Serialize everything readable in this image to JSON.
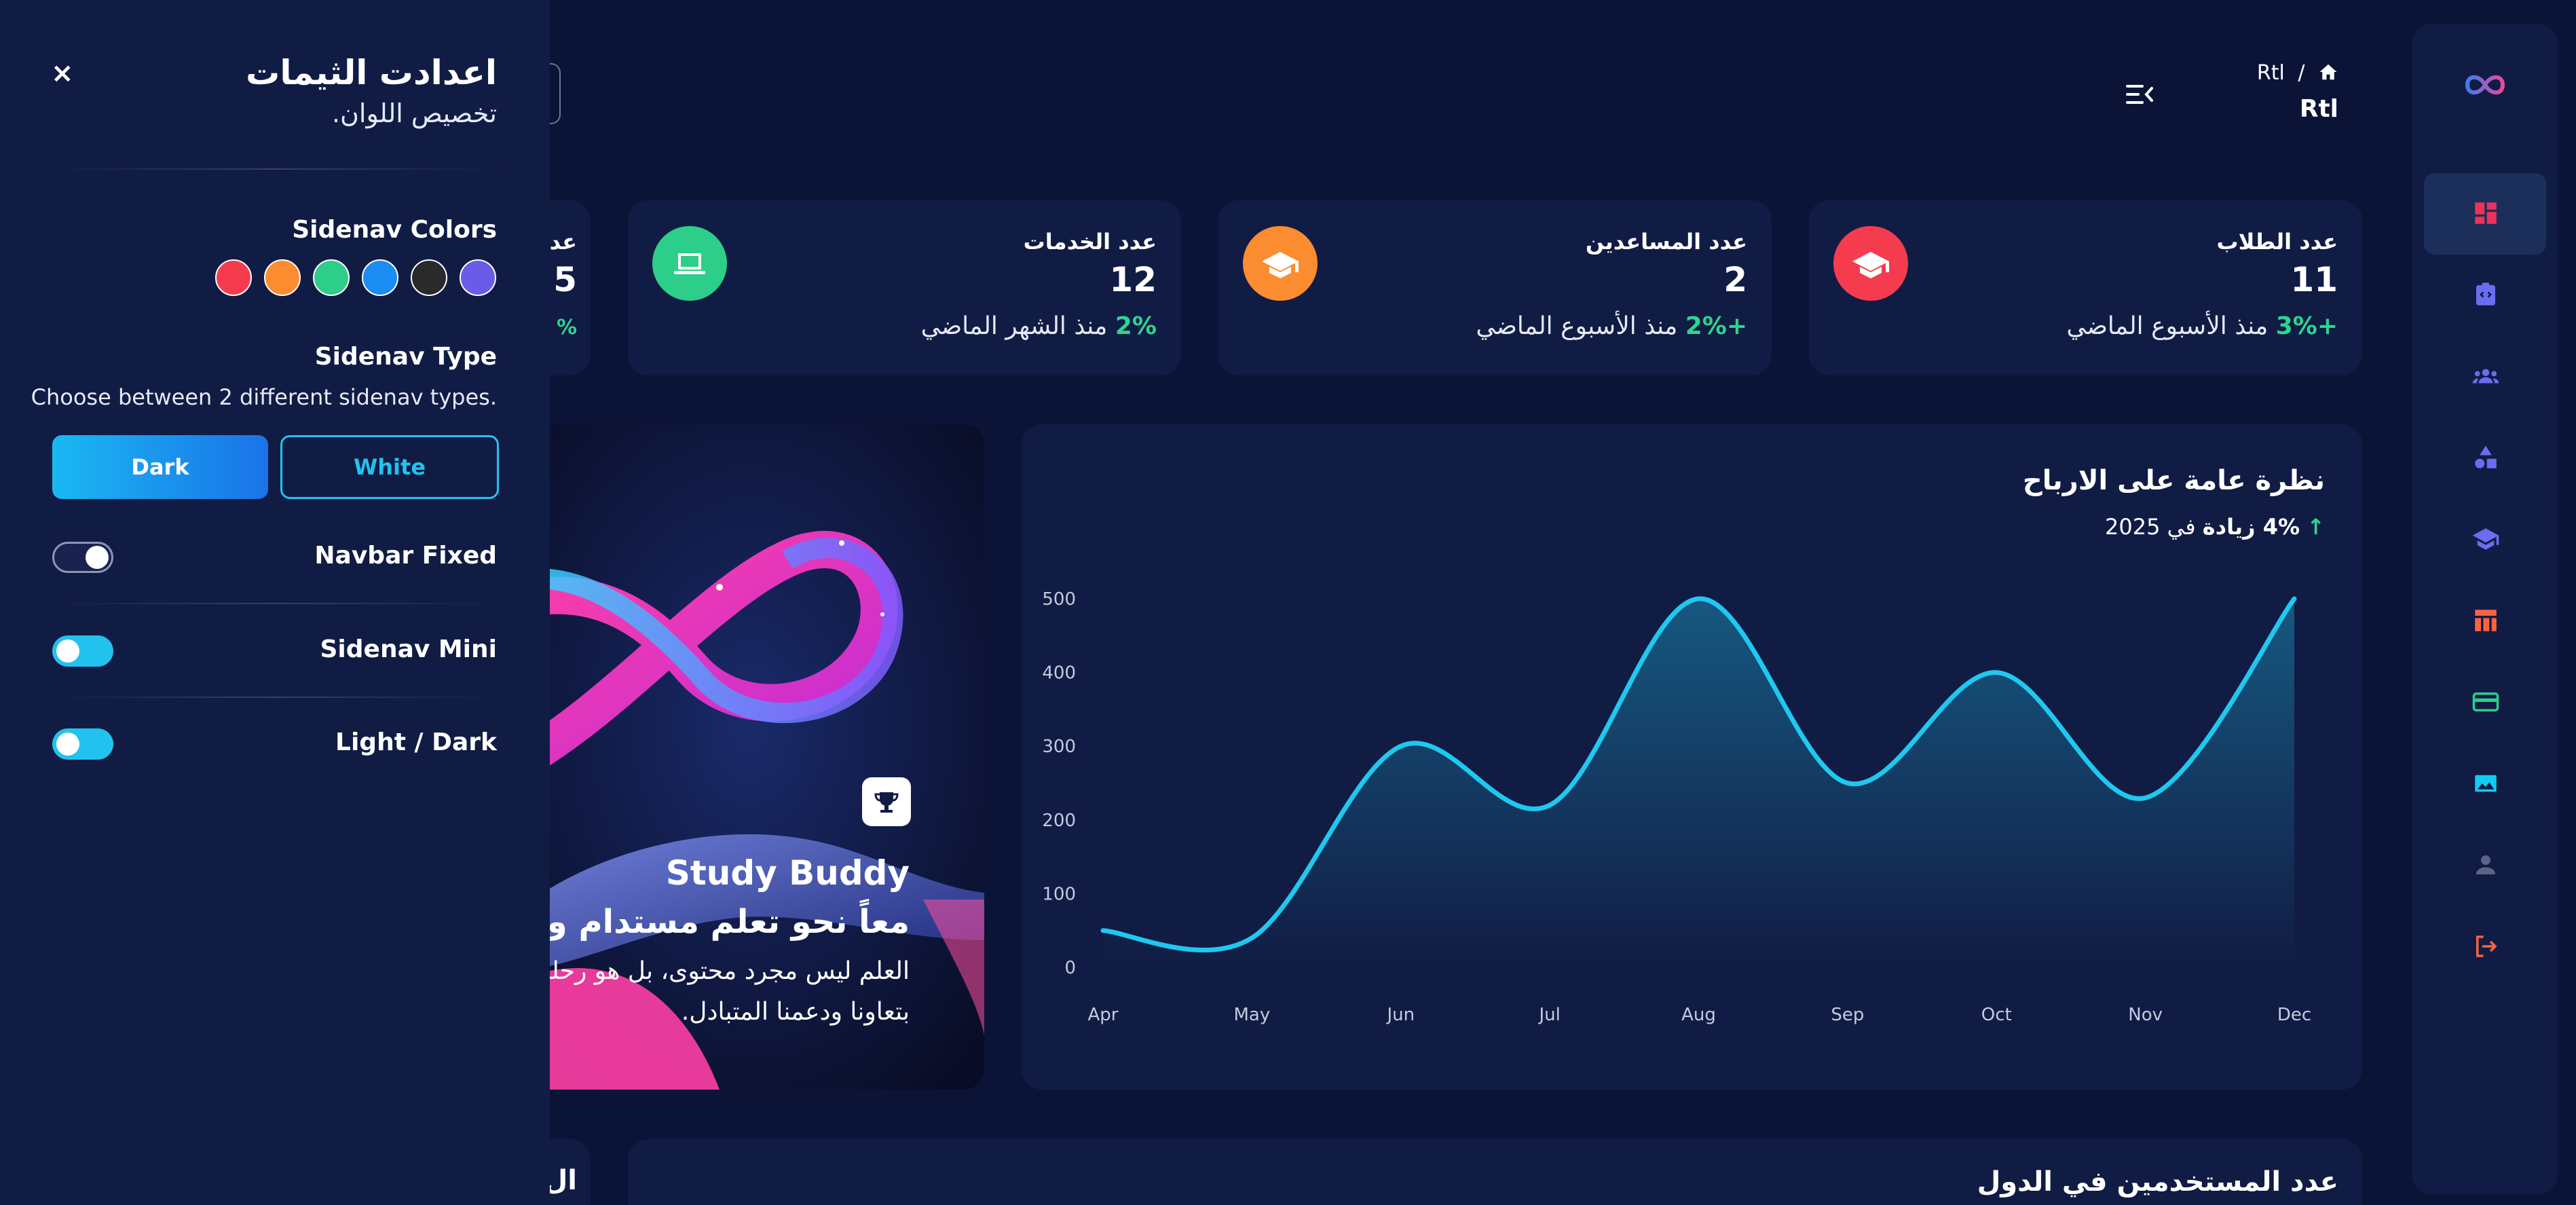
{
  "breadcrumb": {
    "page": "Rtl",
    "separator": "/",
    "title": "Rtl"
  },
  "stats": [
    {
      "title": "عدد الطلاب",
      "value": "11",
      "change": "+3%",
      "period": "منذ الأسبوع الماضي",
      "icon": "graduation-cap-icon",
      "color": "#f53c4f"
    },
    {
      "title": "عدد المساعدين",
      "value": "2",
      "change": "+2%",
      "period": "منذ الأسبوع الماضي",
      "icon": "graduation-cap-icon",
      "color": "#fb8c2f"
    },
    {
      "title": "عدد الخدمات",
      "value": "12",
      "change": "2%",
      "period": "منذ الشهر الماضي",
      "icon": "laptop-icon",
      "color": "#2dce89"
    }
  ],
  "partial_card": {
    "title_fragment": "عد",
    "value_fragment": "5",
    "change_fragment": "%"
  },
  "chart": {
    "title": "نظرة عامة على الارباح",
    "change": "4% زيادة",
    "period": "في 2025",
    "accent": "#1fc8ef"
  },
  "chart_data": {
    "type": "line",
    "categories": [
      "Apr",
      "May",
      "Jun",
      "Jul",
      "Aug",
      "Sep",
      "Oct",
      "Nov",
      "Dec"
    ],
    "series": [
      {
        "values": [
          50,
          40,
          300,
          220,
          500,
          250,
          400,
          230,
          500
        ]
      }
    ],
    "yticks": [
      "0",
      "100",
      "200",
      "300",
      "400",
      "500"
    ],
    "ylim": [
      0,
      500
    ],
    "grid": false
  },
  "hero": {
    "title": "Study Buddy",
    "subtitle": "معاً نحو تعلم مستدام ومش",
    "line1": "العلم ليس مجرد محتوى، بل هو رحلة",
    "line2": "بتعاونا ودعمنا المتبادل."
  },
  "bottom": {
    "title": "عدد المستخدمين في الدول",
    "partial": "ال"
  },
  "config": {
    "title": "اعدادت الثيمات",
    "subtitle": "تخصيص اللوان.",
    "close": "×",
    "sidenav_colors_label": "Sidenav Colors",
    "colors": [
      "#f53c4f",
      "#fb8c2f",
      "#2dce89",
      "#1a8cf2",
      "#2a2a2a",
      "#6a5ce8"
    ],
    "sidenav_type_label": "Sidenav Type",
    "sidenav_type_desc": "Choose between 2 different sidenav types.",
    "btn_dark": "Dark",
    "btn_white": "White",
    "navbar_fixed": "Navbar Fixed",
    "sidenav_mini": "Sidenav Mini",
    "light_dark": "Light / Dark"
  },
  "sidenav": {
    "items": [
      "dashboard-icon",
      "assignment-icon",
      "groups-icon",
      "shapes-icon",
      "school-icon",
      "table-icon",
      "credit-card-icon",
      "image-icon",
      "person-icon",
      "logout-icon"
    ]
  }
}
